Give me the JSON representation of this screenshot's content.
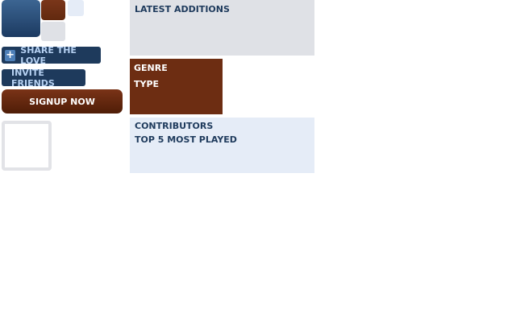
{
  "buttons": {
    "share_label": "SHARE THE LOVE",
    "share_icon": "+",
    "invite_label": "INVITE FRIENDS",
    "signup_label": "SIGNUP NOW"
  },
  "panels": {
    "latest_title": "LATEST ADDITIONS",
    "browse_items": [
      "GENRE",
      "TYPE"
    ],
    "contrib_items": [
      "CONTRIBUTORS",
      "TOP 5 MOST PLAYED"
    ]
  },
  "colors": {
    "navy": "#1e3a5c",
    "brown": "#6d2d12",
    "light_blue": "#e5ecf7",
    "grey": "#dfe1e6"
  }
}
